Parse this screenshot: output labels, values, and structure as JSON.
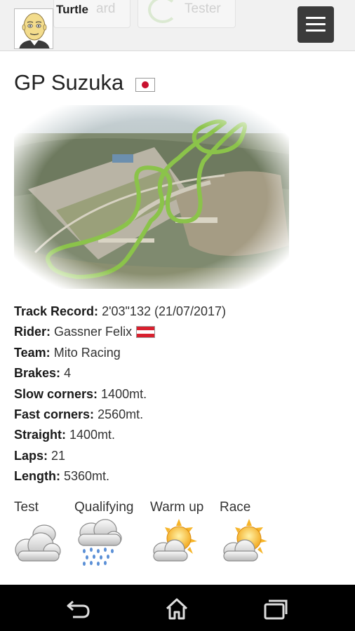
{
  "header": {
    "username": "Turtle",
    "ghost_tabs": [
      "ard",
      "Tester"
    ],
    "menu_icon": "hamburger-menu-icon"
  },
  "circuit": {
    "title": "GP Suzuka",
    "country_flag": "japan-flag"
  },
  "details": [
    {
      "label": "Track Record:",
      "value": "2'03\"132 (21/07/2017)"
    },
    {
      "label": "Rider:",
      "value": "Gassner Felix",
      "flag": "austria-flag"
    },
    {
      "label": "Team:",
      "value": "Mito Racing"
    },
    {
      "label": "Brakes:",
      "value": "4"
    },
    {
      "label": "Slow corners:",
      "value": "1400mt."
    },
    {
      "label": "Fast corners:",
      "value": "2560mt."
    },
    {
      "label": "Straight:",
      "value": "1400mt."
    },
    {
      "label": "Laps:",
      "value": "21"
    },
    {
      "label": "Length:",
      "value": "5360mt."
    }
  ],
  "weather": [
    {
      "session": "Test",
      "icon": "cloudy-icon"
    },
    {
      "session": "Qualifying",
      "icon": "rain-icon"
    },
    {
      "session": "Warm up",
      "icon": "partly-sunny-icon"
    },
    {
      "session": "Race",
      "icon": "partly-sunny-icon"
    }
  ],
  "navbar": {
    "icons": [
      "back-icon",
      "home-icon",
      "recent-apps-icon"
    ]
  },
  "colors": {
    "menu_button": "#3b3b3b",
    "track_line": "#8bc34a",
    "navbar": "#000000"
  }
}
